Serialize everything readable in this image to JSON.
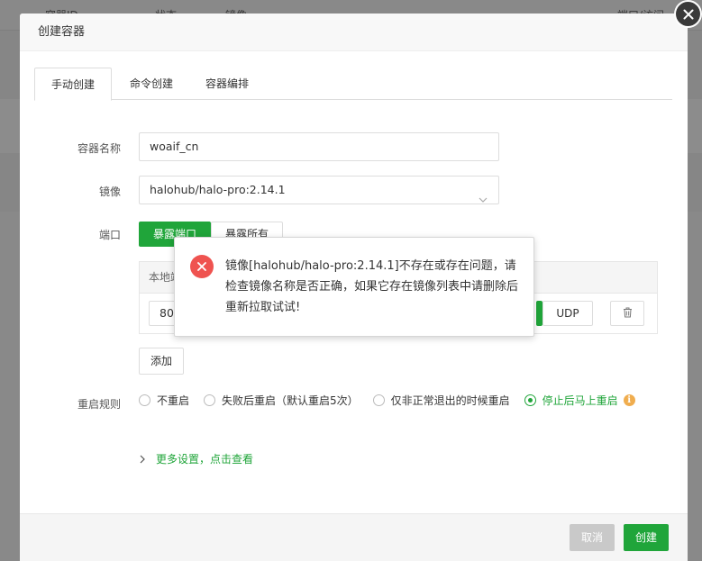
{
  "background": {
    "columns": [
      "容器ID",
      "状态",
      "镜像",
      "端口/访问"
    ]
  },
  "dialog": {
    "title": "创建容器",
    "tabs": [
      "手动创建",
      "命令创建",
      "容器编排"
    ],
    "fields": {
      "name_label": "容器名称",
      "name_value": "woaif_cn",
      "image_label": "镜像",
      "image_value": "halohub/halo-pro:2.14.1",
      "port_label": "端口",
      "port_btn_expose": "暴露端口",
      "port_btn_all": "暴露所有",
      "port_table_header": "本地端口",
      "port_local_value": "80",
      "port_protocol": "UDP",
      "add_button": "添加",
      "restart_label": "重启规则"
    },
    "restart_options": [
      {
        "label": "不重启",
        "selected": false
      },
      {
        "label": "失败后重启（默认重启5次）",
        "selected": false
      },
      {
        "label": "仅非正常退出的时候重启",
        "selected": false
      },
      {
        "label": "停止后马上重启",
        "selected": true
      }
    ],
    "more_settings": "更多设置，点击查看",
    "footer": {
      "cancel": "取消",
      "create": "创建"
    }
  },
  "error_popup": {
    "message": "镜像[halohub/halo-pro:2.14.1]不存在或存在问题，请检查镜像名称是否正确，如果它存在镜像列表中请删除后重新拉取试试!"
  },
  "colors": {
    "accent": "#20a53a",
    "error": "#ef5350",
    "info": "#f0ad4e"
  }
}
